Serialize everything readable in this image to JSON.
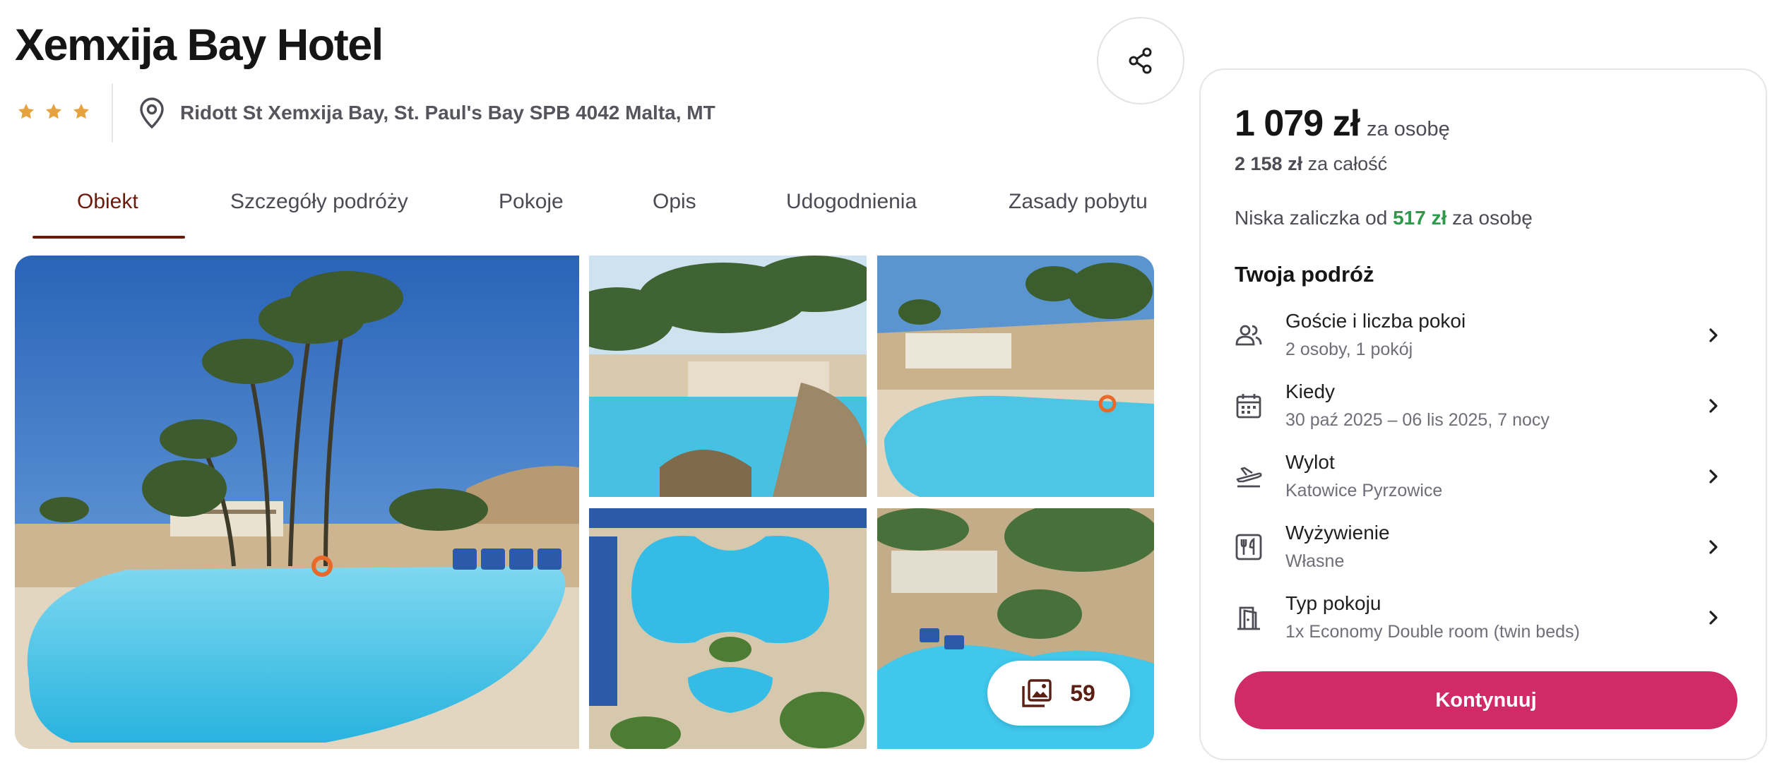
{
  "hotel": {
    "name": "Xemxija Bay Hotel",
    "stars": 3,
    "address": "Ridott St Xemxija Bay, St. Paul's Bay SPB 4042 Malta, MT"
  },
  "tabs": [
    "Obiekt",
    "Szczegóły podróży",
    "Pokoje",
    "Opis",
    "Udogodnienia",
    "Zasady pobytu"
  ],
  "active_tab": "Obiekt",
  "gallery": {
    "count": "59"
  },
  "pricing": {
    "per_person": "1 079 zł",
    "per_person_suffix": "za osobę",
    "total_amount": "2 158 zł",
    "total_suffix": "za całość",
    "deposit_prefix": "Niska zaliczka od",
    "deposit_amount": "517 zł",
    "deposit_suffix": "za osobę"
  },
  "trip": {
    "heading": "Twoja podróż",
    "rows": [
      {
        "label": "Goście i liczba pokoi",
        "value": "2 osoby, 1 pokój",
        "icon": "guests-icon"
      },
      {
        "label": "Kiedy",
        "value": "30 paź 2025 – 06 lis 2025, 7 nocy",
        "icon": "calendar-icon"
      },
      {
        "label": "Wylot",
        "value": "Katowice Pyrzowice",
        "icon": "plane-departure-icon"
      },
      {
        "label": "Wyżywienie",
        "value": "Własne",
        "icon": "meal-icon"
      },
      {
        "label": "Typ pokoju",
        "value": "1x Economy Double room (twin beds)",
        "icon": "room-door-icon"
      }
    ]
  },
  "cta": {
    "label": "Kontynuuj"
  },
  "colors": {
    "accent": "#d12b67",
    "tab_active": "#6a1b0c",
    "star": "#e6a23c",
    "deposit_green": "#2e9a4b"
  }
}
